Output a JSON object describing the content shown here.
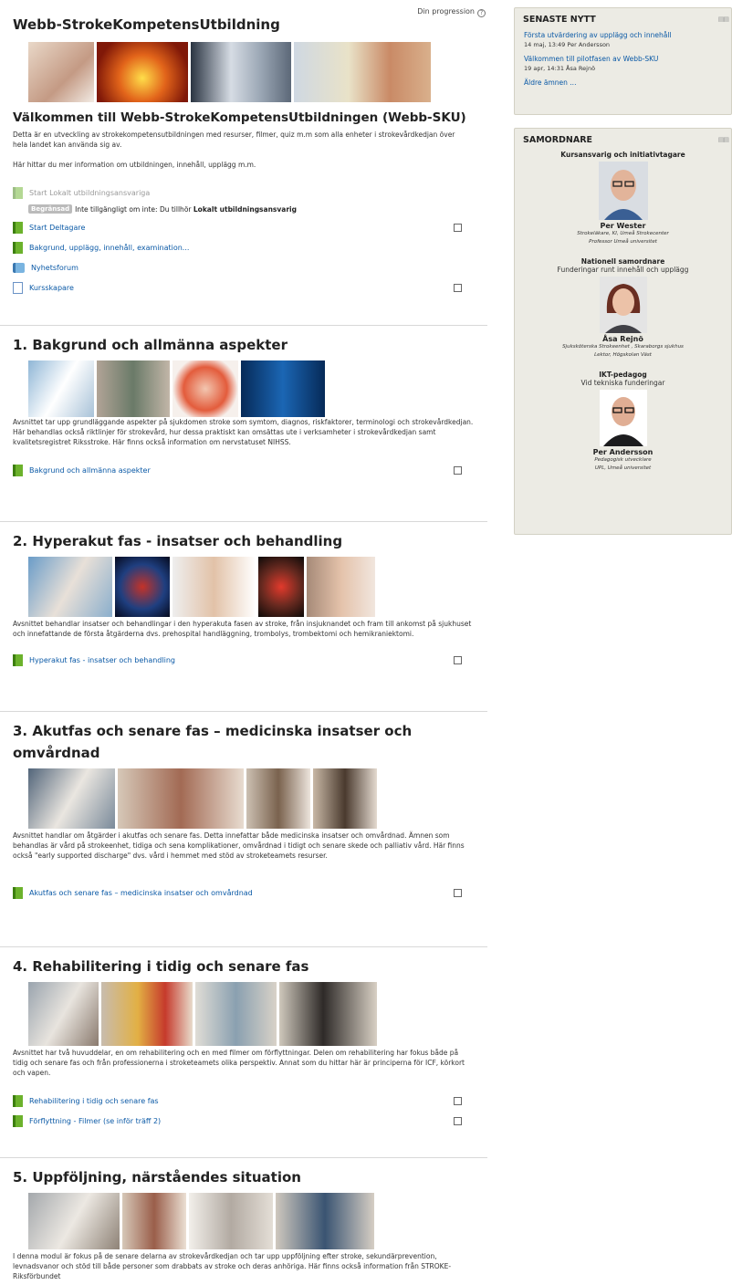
{
  "header": {
    "progress_label": "Din progression",
    "help_glyph": "?",
    "course_title": "Webb-StrokeKompetensUtbildning"
  },
  "intro": {
    "welcome_title": "Välkommen till Webb-StrokeKompetensUtbildningen (Webb-SKU)",
    "summary_1": "Detta är en utveckling av strokekompetensutbildningen med resurser, filmer, quiz m.m som alla enheter i strokevårdkedjan över hela landet kan använda sig av.",
    "summary_2": "Här hittar du mer information om utbildningen, innehåll, upplägg m.m.",
    "activities": [
      {
        "label": "Start Lokalt utbildningsansvariga"
      },
      {
        "label": "Start Deltagare"
      },
      {
        "label": "Bakgrund, upplägg, innehåll, examination..."
      },
      {
        "label": "Nyhetsforum"
      },
      {
        "label": "Kursskapare"
      }
    ],
    "restriction": {
      "badge": "Begränsad",
      "text": "Inte tillgängligt om inte: Du tillhör",
      "group": "Lokalt utbildningsansvarig"
    }
  },
  "sections": [
    {
      "title": "1. Bakgrund och allmänna aspekter",
      "summary": "Avsnittet tar upp grundläggande aspekter på sjukdomen stroke som symtom, diagnos, riskfaktorer, terminologi och strokevårdkedjan. Här behandlas också riktlinjer för strokevård, hur dessa praktiskt kan omsättas ute i verksamheter i strokevårdkedjan samt kvalitetsregistret Riksstroke. Här finns också information om nervstatuset NIHSS.",
      "activities": [
        {
          "label": "Bakgrund och allmänna aspekter"
        }
      ]
    },
    {
      "title": "2. Hyperakut fas - insatser och behandling",
      "summary": "Avsnittet behandlar insatser och behandlingar i den hyperakuta fasen av stroke, från insjuknandet och fram till ankomst på sjukhuset och innefattande de första åtgärderna dvs. prehospital handläggning, trombolys, trombektomi och hemikraniektomi.",
      "activities": [
        {
          "label": "Hyperakut fas - insatser och behandling"
        }
      ]
    },
    {
      "title": "3. Akutfas och senare fas – medicinska insatser och omvårdnad",
      "summary": "Avsnittet handlar om åtgärder i akutfas och senare fas. Detta innefattar både medicinska insatser och omvårdnad. Ämnen som behandlas är vård på strokeenhet, tidiga och sena komplikationer, omvårdnad i tidigt och senare skede och palliativ vård. Här finns också \"early supported discharge\" dvs. vård i hemmet med stöd av stroketeamets resurser.",
      "activities": [
        {
          "label": "Akutfas och senare fas – medicinska insatser och omvårdnad"
        }
      ]
    },
    {
      "title": "4. Rehabilitering i tidig och senare fas",
      "summary": "Avsnittet har två huvuddelar, en om rehabilitering och en med filmer om förflyttningar. Delen om rehabilitering har fokus både på tidig och senare fas och från professionerna i stroketeamets olika perspektiv. Annat som du hittar här är principerna för ICF, körkort och vapen.",
      "activities": [
        {
          "label": "Rehabilitering i tidig och senare fas"
        },
        {
          "label": "Förflyttning - Filmer (se inför träff 2)"
        }
      ]
    },
    {
      "title": "5. Uppföljning, närståendes situation",
      "summary": "I denna modul är fokus på de senare delarna av strokevårdkedjan och tar upp uppföljning efter stroke, sekundärprevention, levnadsvanor och stöd till både personer som drabbats av stroke och deras anhöriga. Här finns också information från STROKE-Riksförbundet",
      "activities": []
    }
  ],
  "news": {
    "title": "SENASTE NYTT",
    "items": [
      {
        "link": "Första utvärdering av upplägg och innehåll",
        "meta": "14 maj, 13:49 Per Andersson"
      },
      {
        "link": "Välkommen till pilotfasen av Webb-SKU",
        "meta": "19 apr, 14:31 Åsa Rejnö"
      }
    ],
    "older": "Äldre ämnen ..."
  },
  "coordinators": {
    "title": "SAMORDNARE",
    "people": [
      {
        "role": "Kursansvarig och initiativtagare",
        "sub": "",
        "name": "Per Wester",
        "meta1": "Strokeläkare, KI, Umeå Strokecenter",
        "meta2": "Professor Umeå universitet"
      },
      {
        "role": "Nationell samordnare",
        "sub": "Funderingar runt innehåll och upplägg",
        "name": "Åsa Rejnö",
        "meta1": "Sjuksköterska Strokeenhet , Skaraborgs sjukhus",
        "meta2": "Lektor, Högskolan Väst"
      },
      {
        "role": "IKT-pedagog",
        "sub": "Vid tekniska funderingar",
        "name": "Per Andersson",
        "meta1": "Pedagogisk utvecklare",
        "meta2": "UPL, Umeå universitet"
      }
    ]
  },
  "colors": {
    "link": "#0a59a6",
    "block_bg": "#ecebe4",
    "activity_icon": "#6cb22c"
  }
}
